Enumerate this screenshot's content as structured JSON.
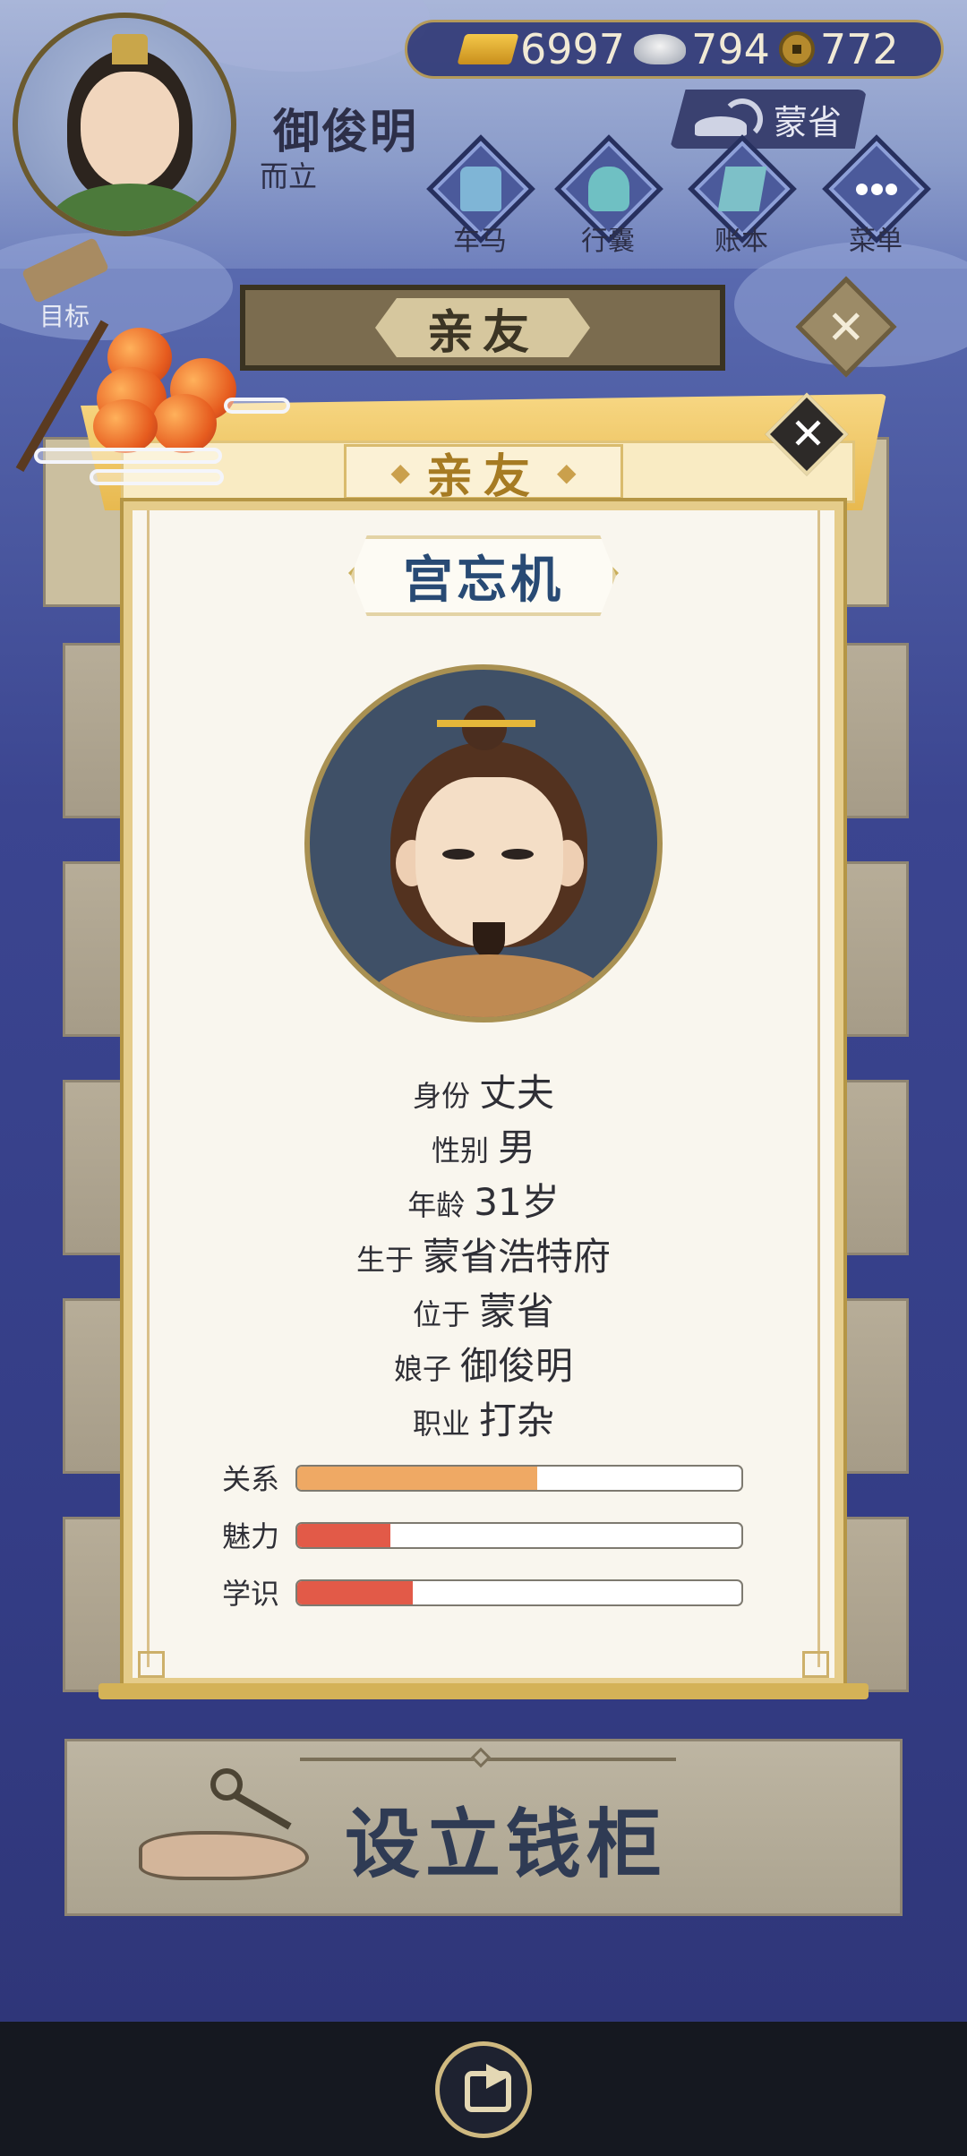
{
  "player": {
    "name": "御俊明",
    "age_label": "而立"
  },
  "currency": {
    "gold": "6997",
    "silver": "794",
    "copper": "772"
  },
  "location": {
    "label": "蒙省",
    "icon": "teapot-icon"
  },
  "nav": [
    {
      "label": "车马",
      "icon": "carriage-icon"
    },
    {
      "label": "行囊",
      "icon": "bag-icon"
    },
    {
      "label": "账本",
      "icon": "ledger-icon"
    },
    {
      "label": "菜单",
      "icon": "menu-icon"
    }
  ],
  "goal": {
    "label": "目标",
    "icon": "scroll-icon"
  },
  "section": {
    "title": "亲友",
    "close_icon": "close-icon"
  },
  "dialog": {
    "title": "亲友",
    "close_icon": "close-icon",
    "npc_name": "宫忘机",
    "info": [
      {
        "key": "身份",
        "value": "丈夫"
      },
      {
        "key": "性别",
        "value": "男"
      },
      {
        "key": "年龄",
        "value": "31岁"
      },
      {
        "key": "生于",
        "value": "蒙省浩特府"
      },
      {
        "key": "位于",
        "value": "蒙省"
      },
      {
        "key": "娘子",
        "value": "御俊明"
      },
      {
        "key": "职业",
        "value": "打杂"
      }
    ],
    "stats": [
      {
        "label": "关系",
        "value": 0.54,
        "color": "#efa964"
      },
      {
        "label": "魅力",
        "value": 0.21,
        "color": "#e25a48"
      },
      {
        "label": "学识",
        "value": 0.26,
        "color": "#e25a48"
      }
    ]
  },
  "action": {
    "label": "设立钱柜",
    "icon": "key-hand-icon"
  },
  "bottom": {
    "share_icon": "share-icon"
  }
}
